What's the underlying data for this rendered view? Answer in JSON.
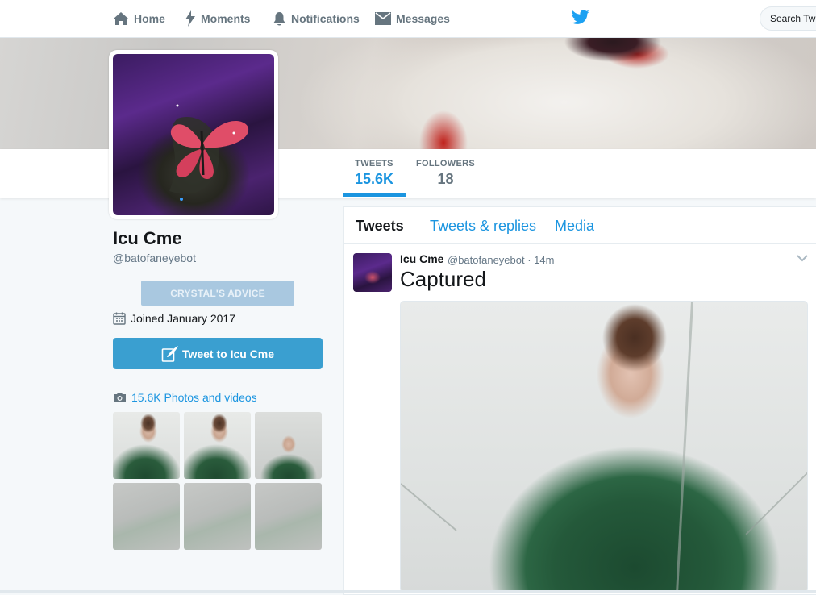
{
  "nav": {
    "home": "Home",
    "moments": "Moments",
    "notifications": "Notifications",
    "messages": "Messages",
    "search_placeholder": "Search Twi"
  },
  "profile": {
    "name": "Icu Cme",
    "handle": "@batofaneyebot",
    "advice_button": "CRYSTAL'S ADVICE",
    "joined": "Joined January 2017",
    "tweet_to_button": "Tweet to Icu Cme",
    "photos_link": "15.6K Photos and videos"
  },
  "stats": [
    {
      "label": "TWEETS",
      "value": "15.6K"
    },
    {
      "label": "FOLLOWERS",
      "value": "18"
    }
  ],
  "timeline": {
    "tabs": [
      "Tweets",
      "Tweets & replies",
      "Media"
    ],
    "tweet": {
      "name": "Icu Cme",
      "meta": "@batofaneyebot · 14m",
      "text": "Captured"
    }
  },
  "colors": {
    "accent": "#1b95e0",
    "button": "#3a9fd0",
    "advice_button": "#a9c8e0"
  }
}
